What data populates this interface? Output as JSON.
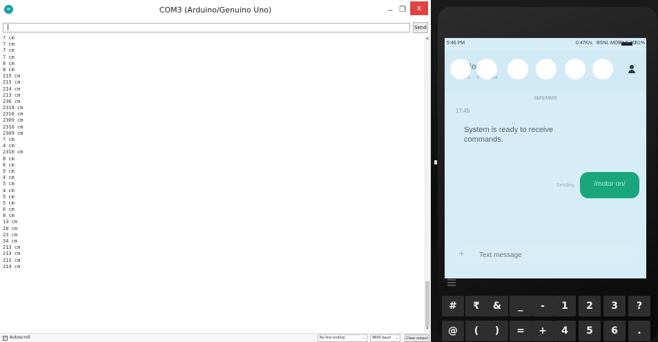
{
  "serial_monitor": {
    "title": "COM3 (Arduino/Genuino Uno)",
    "window_controls": {
      "minimize": "–",
      "maximize": "❐",
      "close": "x"
    },
    "send_input": {
      "value": "|",
      "placeholder": ""
    },
    "send_label": "Send",
    "output_lines": [
      "7 cm",
      "7 cm",
      "7 cm",
      "7 cm",
      "8 cm",
      "8 cm",
      "215 cm",
      "213 cm",
      "214 cm",
      "213 cm",
      "236 cm",
      "2310 cm",
      "2310 cm",
      "2309 cm",
      "2310 cm",
      "2309 cm",
      "7 cm",
      "4 cm",
      "2310 cm",
      "8 cm",
      "6 cm",
      "5 cm",
      "4 cm",
      "5 cm",
      "4 cm",
      "5 cm",
      "5 cm",
      "6 cm",
      "8 cm",
      "13 cm",
      "20 cm",
      "23 cm",
      "34 cm",
      "213 cm",
      "213 cm",
      "213 cm",
      "214 cm"
    ],
    "scroll_arrows": {
      "up": "▲",
      "down": "▼"
    },
    "autoscroll": {
      "label": "Autoscroll",
      "checked": "✓"
    },
    "line_ending": {
      "value": "No line ending",
      "chevron": "⌄"
    },
    "baud_rate": {
      "value": "9600 baud",
      "chevron": "⌄"
    },
    "clear_label": "Clear output"
  },
  "phone": {
    "status": {
      "time": "5:46 PM",
      "speed": "0.47K/s",
      "network": "BSNL MOBILE 3G",
      "battery": "51%"
    },
    "contact": {
      "name": "Ho   ell",
      "sub": "91 ·· 97·· ·· dia"
    },
    "channel_label": "SMS/MMS",
    "message_time": "17:45",
    "incoming_message": "System is ready to receive commands.",
    "sending_label": "Sending",
    "outgoing_message": "/motor on/",
    "compose_placeholder": "Text message",
    "plus_glyph": "+",
    "keyboard_rows": [
      [
        "#",
        "₹",
        "&",
        "_",
        "-",
        "1",
        "2",
        "3",
        "?"
      ],
      [
        "@",
        "(",
        ")",
        "=",
        "+",
        "4",
        "5",
        "6",
        "."
      ]
    ]
  }
}
